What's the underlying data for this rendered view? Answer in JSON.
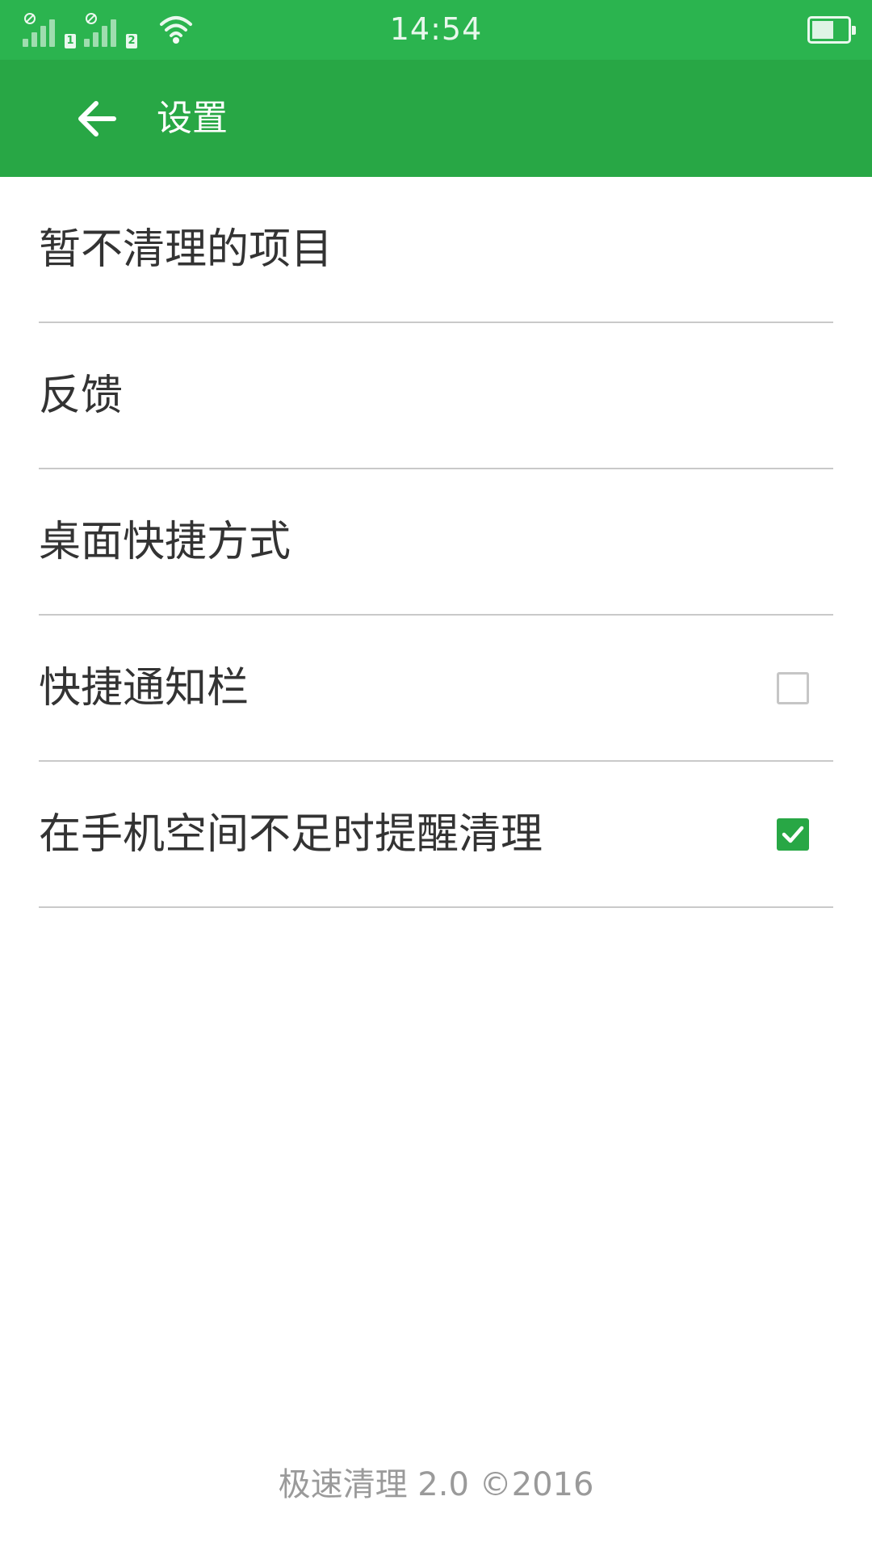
{
  "status_bar": {
    "time": "14:54",
    "sim1_label": "1",
    "sim2_label": "2",
    "icons": [
      "signal-sim1-icon",
      "signal-sim2-icon",
      "wifi-icon",
      "battery-icon"
    ]
  },
  "app_bar": {
    "title": "设置",
    "back_icon": "arrow-left-icon",
    "color": "#28a745"
  },
  "settings": {
    "items": [
      {
        "label": "暂不清理的项目"
      },
      {
        "label": "反馈"
      },
      {
        "label": "桌面快捷方式"
      },
      {
        "label": "快捷通知栏",
        "checked": false
      },
      {
        "label": "在手机空间不足时提醒清理",
        "checked": true
      }
    ]
  },
  "footer": {
    "text": "极速清理 2.0 ©2016"
  },
  "colors": {
    "accent": "#28a745",
    "text": "#333333",
    "divider": "#c9c9c9"
  }
}
